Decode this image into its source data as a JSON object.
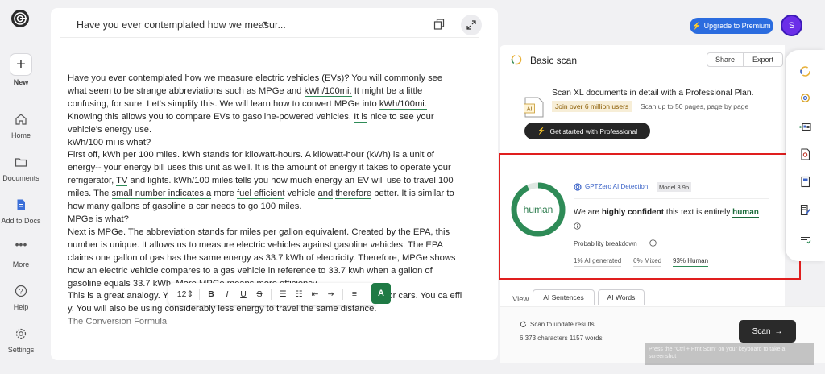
{
  "app": {
    "nav": {
      "new_label": "New",
      "items": [
        {
          "label": "Home",
          "icon": "home-icon"
        },
        {
          "label": "Documents",
          "icon": "folder-icon"
        },
        {
          "label": "Add to Docs",
          "icon": "document-icon"
        },
        {
          "label": "More",
          "icon": "more-dots-icon"
        },
        {
          "label": "Help",
          "icon": "help-icon"
        },
        {
          "label": "Settings",
          "icon": "gear-icon"
        }
      ]
    },
    "accent_color": "#2e8b57",
    "brand_blue": "#2b6cdf"
  },
  "editor": {
    "title": "Have you ever contemplated how we measur...",
    "paragraphs": [
      [
        {
          "t": "Have you ever contemplated how we measure electric vehicles (EVs)? You will commonly see what seem to be strange abbreviations such as MPGe and "
        },
        {
          "t": "kWh/100mi.",
          "u": true
        },
        {
          "t": " It might be a little confusing, for sure. Let's simplify this. We will learn how to convert MPGe into "
        },
        {
          "t": "kWh/100mi.",
          "u": true
        },
        {
          "t": " Knowing this allows you to compare EVs to gasoline-powered vehicles. "
        },
        {
          "t": "It is",
          "u": true
        },
        {
          "t": " nice to see your vehicle's energy use."
        }
      ],
      [
        {
          "t": "kWh/100 mi is what?"
        }
      ],
      [
        {
          "t": "First off, kWh per 100 miles. kWh stands for kilowatt-hours. A kilowatt-hour (kWh) is a unit of energy-- your energy bill uses this unit as well. It is the amount of energy it takes to operate your refrigerator, "
        },
        {
          "t": "TV",
          "u": true
        },
        {
          "t": " and lights. kWh/100 miles tells you how much energy an EV will use to travel 100 miles. The "
        },
        {
          "t": "small number indicates a",
          "u": true
        },
        {
          "t": " more "
        },
        {
          "t": "fuel efficient",
          "u": true
        },
        {
          "t": " vehicle "
        },
        {
          "t": "and",
          "u": true
        },
        {
          "t": " "
        },
        {
          "t": "therefore",
          "u": true
        },
        {
          "t": " better. It is similar to how many gallons of gasoline a car needs to go 100 miles."
        }
      ],
      [
        {
          "t": "MPGe is what?"
        }
      ],
      [
        {
          "t": "Next is MPGe. The abbreviation stands for miles per gallon equivalent. Created by the EPA, this number is unique. It allows us to measure electric vehicles against gasoline vehicles. The EPA claims one gallon of gas has the same energy as 33.7 kWh of electricity. Therefore, MPGe shows how an electric vehicle compares to a gas vehicle in reference to 33.7 "
        },
        {
          "t": "kwh when a gallon of gasoline equals 33.7 kWh.",
          "u": true
        },
        {
          "t": " More MPGe means more efficiency."
        }
      ],
      [
        {
          "t": "This is a great analogy. Y                                                                               with 30 mpg and t     EV with 120 MPGe while shopping for cars. You ca                                                                               effi      y. You will also be using considerably less energy to travel the same distance."
        }
      ],
      [
        {
          "t": "The Conversion Formula"
        }
      ]
    ],
    "toolbar": {
      "font_size": "12",
      "items": [
        "B",
        "I",
        "U",
        "S"
      ]
    },
    "assist_button": "A"
  },
  "header": {
    "upgrade_label": "Upgrade to Premium",
    "avatar_initial": "S"
  },
  "scan": {
    "title": "Basic scan",
    "share_label": "Share",
    "export_label": "Export",
    "promo": {
      "heading": "Scan XL documents in detail with a Professional Plan.",
      "badge": "Join over 6 million users",
      "sub": "Scan up to 50 pages, page by page",
      "cta": "Get started with Professional",
      "doc_icon_text": "AI"
    },
    "result": {
      "verdict": "human",
      "human_fraction": 0.93,
      "detector_label": "GPTZero AI Detection",
      "model": "Model 3.9b",
      "confidence_prefix": "We are ",
      "confidence_strong": "highly confident",
      "confidence_mid": " this text is entirely ",
      "confidence_class": "human",
      "prob_label": "Probability breakdown",
      "ai_pct": "1% AI generated",
      "mixed_pct": "6% Mixed",
      "human_pct": "93% Human"
    },
    "view_label": "View",
    "view_tabs": [
      "AI Sentences",
      "AI Words"
    ],
    "rescan_label": "Scan to update results",
    "chars_label": "6,373 characters 1157 words",
    "scan_button": "Scan",
    "tooltip": "Press the \"Ctrl + Prnt Scrn\" on your keyboard to take a screenshot"
  }
}
